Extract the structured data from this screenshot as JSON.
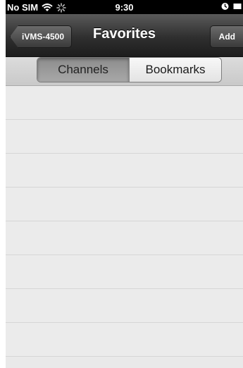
{
  "status_bar": {
    "carrier": "No SIM",
    "time": "9:30",
    "icons": [
      "wifi-icon",
      "spinner-icon",
      "lock-icon",
      "battery-icon"
    ]
  },
  "nav": {
    "back_label": "iVMS-4500",
    "title": "Favorites",
    "add_label": "Add"
  },
  "segments": {
    "channels": "Channels",
    "bookmarks": "Bookmarks",
    "selected": "Channels"
  },
  "list": {
    "rows": [
      "",
      "",
      "",
      "",
      "",
      "",
      "",
      ""
    ]
  },
  "colors": {
    "nav_bar": "#2f2f2f",
    "background": "#e9e9e9",
    "row_separator": "#d6d6d6"
  }
}
